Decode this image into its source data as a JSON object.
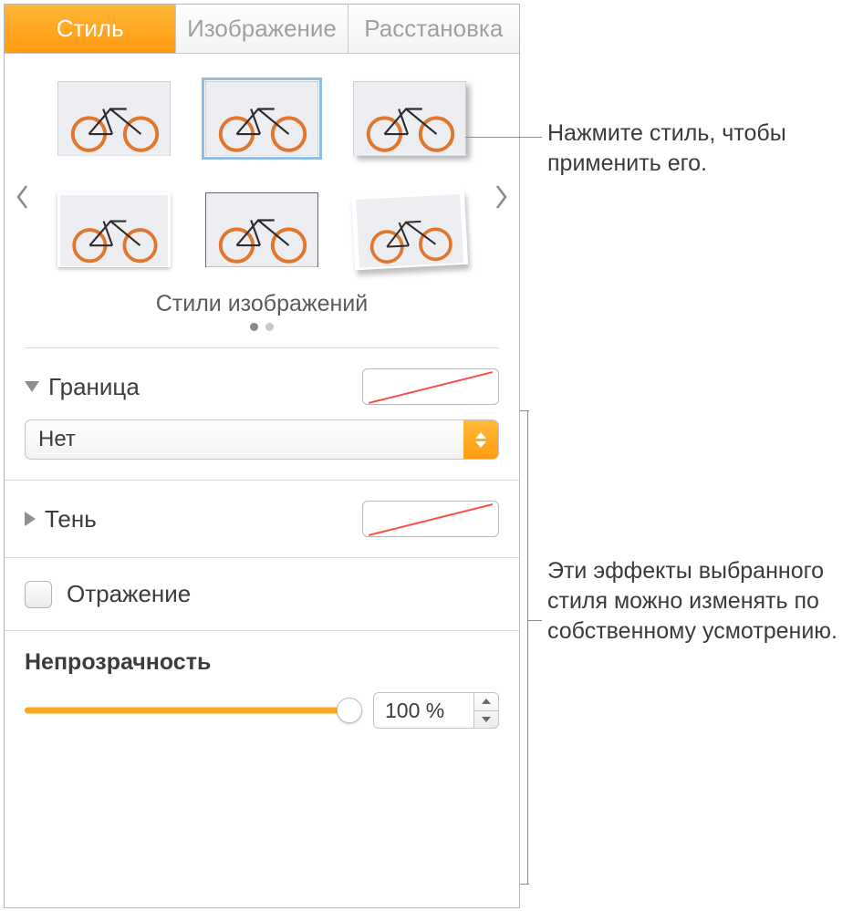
{
  "tabs": {
    "style": "Стиль",
    "image": "Изображение",
    "arrange": "Расстановка"
  },
  "gallery": {
    "title": "Стили изображений"
  },
  "border": {
    "label": "Граница",
    "value": "Нет"
  },
  "shadow": {
    "label": "Тень"
  },
  "reflection": {
    "label": "Отражение"
  },
  "opacity": {
    "label": "Непрозрачность",
    "value": "100 %"
  },
  "callouts": {
    "styleTip": "Нажмите стиль, чтобы применить его.",
    "effectsTip": "Эти эффекты выбранного стиля можно изменять по собственному усмотрению."
  }
}
